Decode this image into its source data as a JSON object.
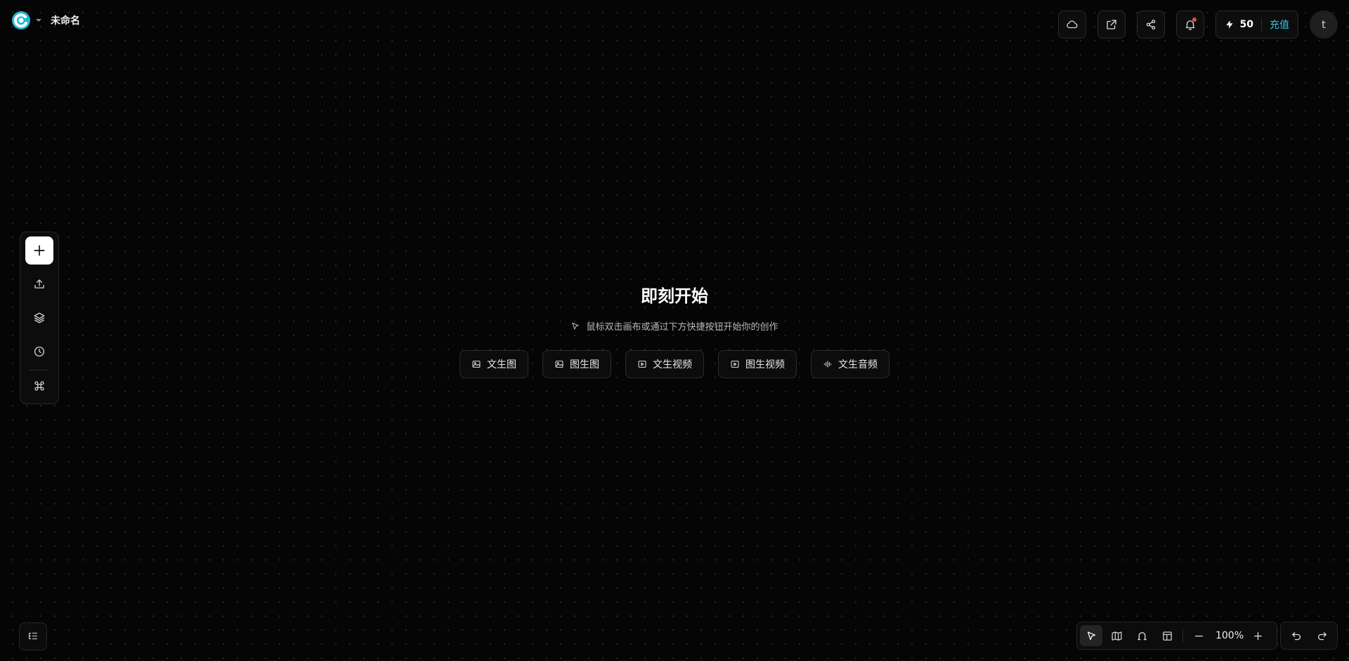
{
  "header": {
    "doc_title": "未命名",
    "icons": [
      "cloud-icon",
      "external-link-icon",
      "share-icon",
      "bell-icon"
    ],
    "credits": {
      "count": "50",
      "recharge_label": "充值"
    },
    "avatar_initial": "t",
    "accent_color": "#2dc6e0"
  },
  "left_toolbar": {
    "items": [
      "add-icon",
      "upload-icon",
      "layers-icon",
      "history-icon",
      "command-icon"
    ]
  },
  "center": {
    "headline": "即刻开始",
    "hint": "鼠标双击画布或通过下方快捷按钮开始你的创作",
    "quick_actions": [
      {
        "label": "文生图",
        "icon": "image-icon"
      },
      {
        "label": "图生图",
        "icon": "image-icon"
      },
      {
        "label": "文生视频",
        "icon": "video-icon"
      },
      {
        "label": "图生视频",
        "icon": "video-icon"
      },
      {
        "label": "文生音频",
        "icon": "audio-wave-icon"
      }
    ]
  },
  "bottom": {
    "zoom": "100%",
    "tools": [
      "select-pointer-icon",
      "map-icon",
      "magnet-icon",
      "layout-icon"
    ]
  }
}
